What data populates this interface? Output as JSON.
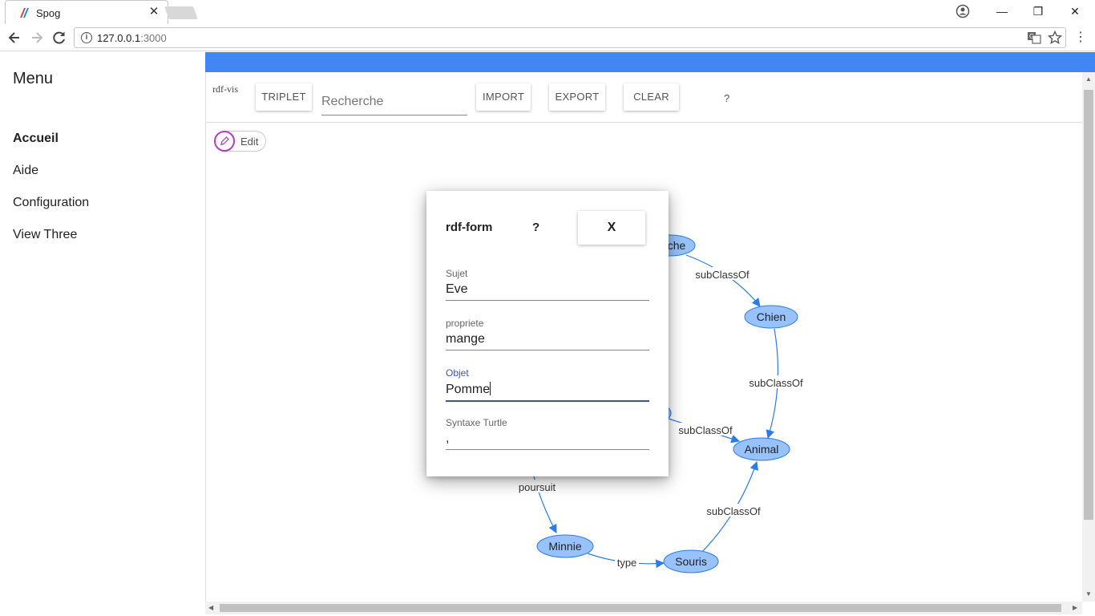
{
  "browser": {
    "tab_title": "Spog",
    "tab_close": "✕",
    "url_host": "127.0.0.1",
    "url_port": ":3000",
    "controls": {
      "minimize": "—",
      "restore": "❐",
      "close": "✕"
    },
    "icons": {
      "back": "arrow-left-icon",
      "forward": "arrow-right-icon",
      "reload": "reload-icon",
      "translate": "translate-icon",
      "bookmark": "star-icon",
      "menu": "kebab-menu-icon",
      "account": "account-icon"
    }
  },
  "sidebar": {
    "title": "Menu",
    "items": [
      {
        "label": "Accueil",
        "active": true
      },
      {
        "label": "Aide",
        "active": false
      },
      {
        "label": "Configuration",
        "active": false
      },
      {
        "label": "View Three",
        "active": false
      }
    ]
  },
  "toolbar": {
    "vis_label": "rdf-vis",
    "triplet_label": "TRIPLET",
    "search_placeholder": "Recherche",
    "import_label": "IMPORT",
    "export_label": "EXPORT",
    "clear_label": "CLEAR",
    "help_label": "?",
    "edit_label": "Edit"
  },
  "graph": {
    "nodes": [
      {
        "id": "vache",
        "label": "che"
      },
      {
        "id": "chien",
        "label": "Chien"
      },
      {
        "id": "animal",
        "label": "Animal"
      },
      {
        "id": "minnie",
        "label": "Minnie"
      },
      {
        "id": "souris",
        "label": "Souris"
      }
    ],
    "edges": [
      {
        "from": "vache",
        "to": "chien",
        "label": "subClassOf"
      },
      {
        "from": "chien",
        "to": "animal",
        "label": "subClassOf"
      },
      {
        "from": "hidden",
        "to": "animal",
        "label": "subClassOf"
      },
      {
        "from": "hidden",
        "to": "minnie",
        "label": "poursuit"
      },
      {
        "from": "minnie",
        "to": "souris",
        "label": "type"
      },
      {
        "from": "souris",
        "to": "animal",
        "label": "subClassOf"
      }
    ],
    "colors": {
      "node_fill": "#97c2fc",
      "node_border": "#2b7ce9",
      "edge": "#2b7ce9"
    }
  },
  "dialog": {
    "title": "rdf-form",
    "help": "?",
    "close_label": "X",
    "fields": [
      {
        "label": "Sujet",
        "value": "Eve",
        "focused": false
      },
      {
        "label": "propriete",
        "value": "mange",
        "focused": false
      },
      {
        "label": "Objet",
        "value": "Pomme",
        "focused": true
      },
      {
        "label": "Syntaxe Turtle",
        "value": ",",
        "focused": false
      }
    ]
  },
  "colors": {
    "appbar": "#4285f4",
    "focus": "#3f51b5",
    "edit_icon": "#b03dc0"
  }
}
